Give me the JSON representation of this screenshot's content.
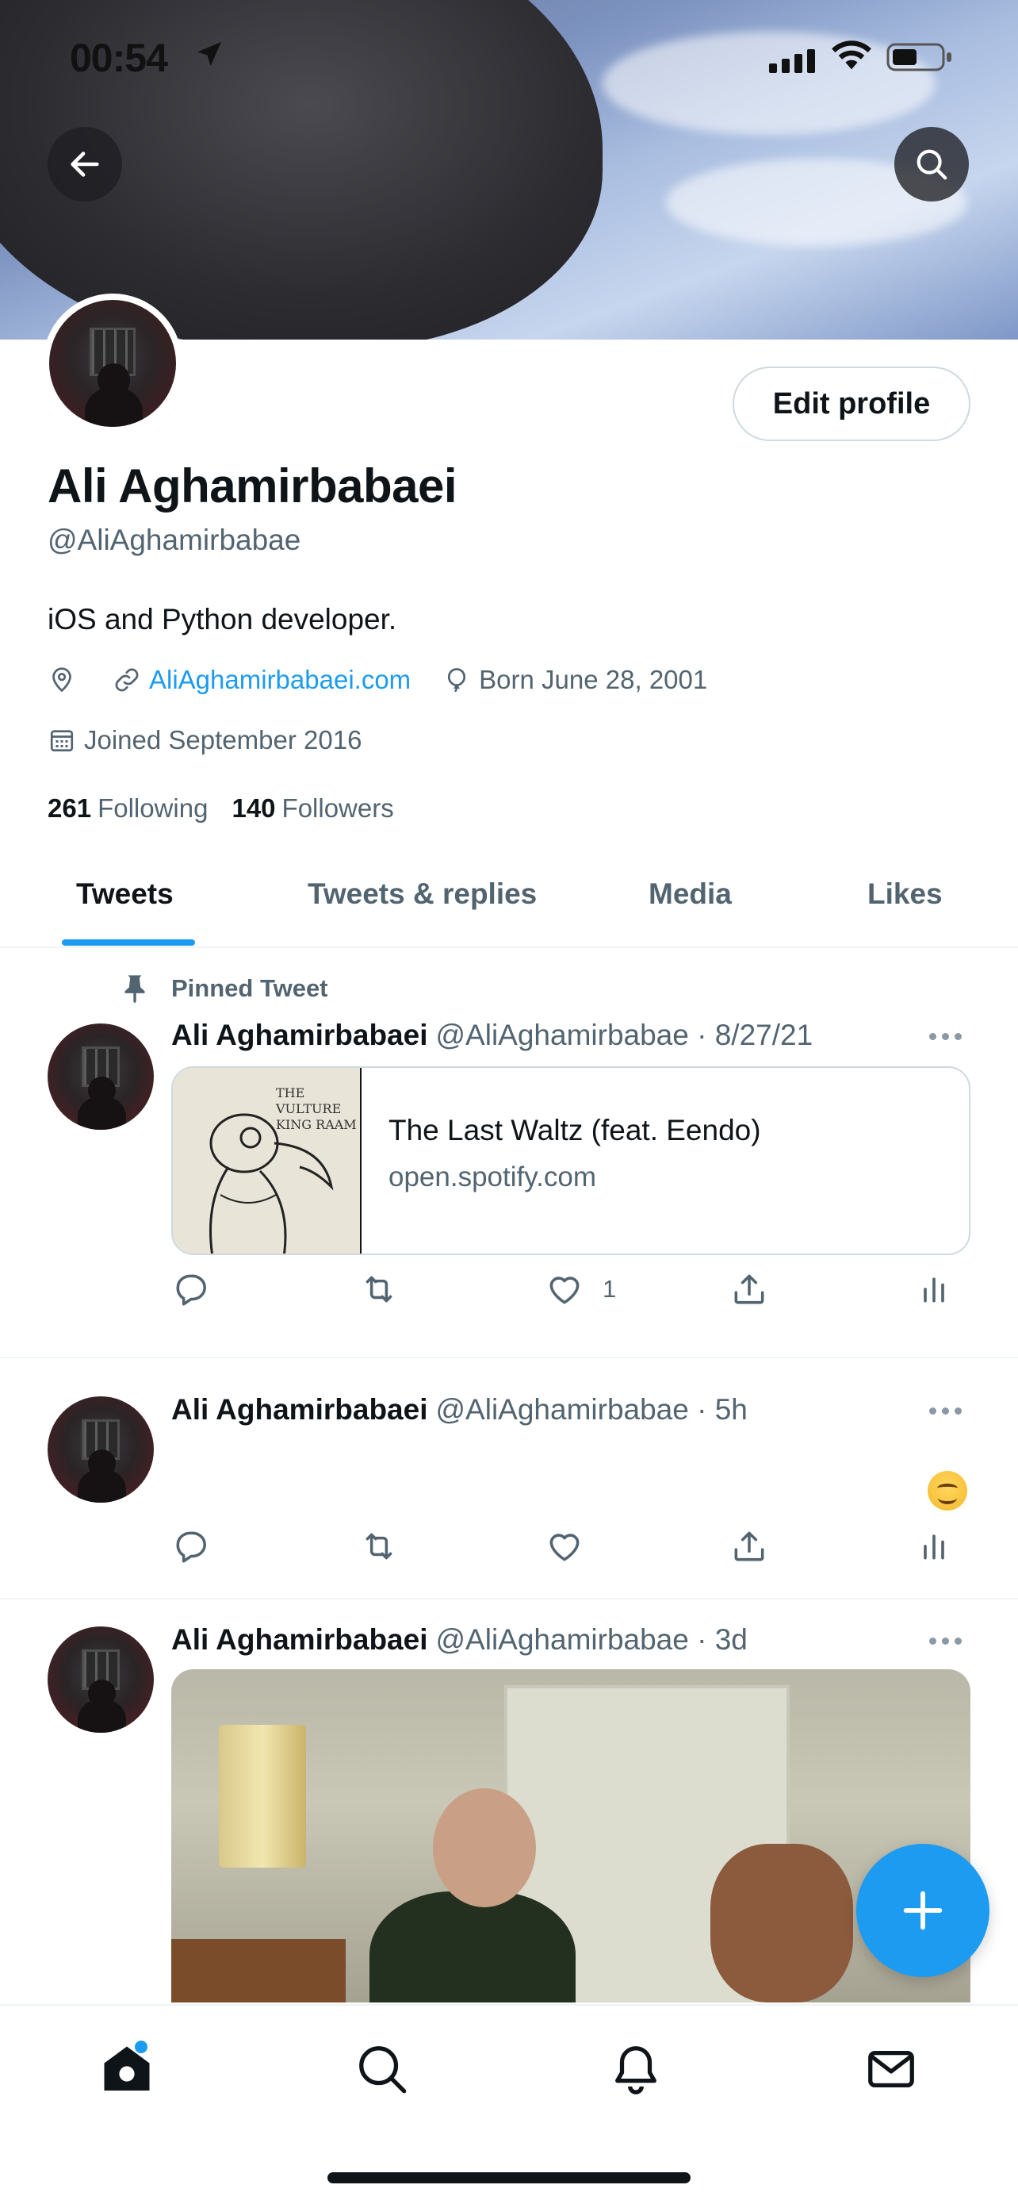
{
  "status_bar": {
    "time": "00:54"
  },
  "profile": {
    "name": "Ali Aghamirbabaei",
    "handle": "@AliAghamirbabae",
    "bio": "iOS and Python developer.",
    "website": "AliAghamirbabaei.com",
    "born": "Born June 28, 2001",
    "joined": "Joined September 2016",
    "following_count": "261",
    "following_label": "Following",
    "followers_count": "140",
    "followers_label": "Followers",
    "edit_label": "Edit profile"
  },
  "tabs": [
    {
      "label": "Tweets",
      "active": true
    },
    {
      "label": "Tweets & replies",
      "active": false
    },
    {
      "label": "Media",
      "active": false
    },
    {
      "label": "Likes",
      "active": false
    }
  ],
  "tweets": [
    {
      "pinned_label": "Pinned Tweet",
      "name": "Ali Aghamirbabaei",
      "meta": "@AliAghamirbabae · 8/27/21",
      "card": {
        "title": "The Last Waltz (feat. Eendo)",
        "domain": "open.spotify.com",
        "art_text_1": "THE VULTURE",
        "art_text_2": "KING RAAM"
      },
      "like_count": "1"
    },
    {
      "name": "Ali Aghamirbabaei",
      "meta": "@AliAghamirbabae · 5h",
      "emoji": "smiling-face"
    },
    {
      "name": "Ali Aghamirbabaei",
      "meta": "@AliAghamirbabae · 3d"
    }
  ],
  "colors": {
    "accent": "#1d9bf0",
    "text": "#0f1419",
    "secondary": "#536471",
    "border": "#cfd9de"
  },
  "icons": [
    "back-arrow-icon",
    "search-icon",
    "location-icon",
    "link-icon",
    "balloon-icon",
    "calendar-icon",
    "pin-icon",
    "reply-icon",
    "retweet-icon",
    "like-icon",
    "share-icon",
    "analytics-icon",
    "more-icon",
    "compose-plus-icon",
    "home-icon",
    "explore-icon",
    "notifications-icon",
    "messages-icon"
  ]
}
